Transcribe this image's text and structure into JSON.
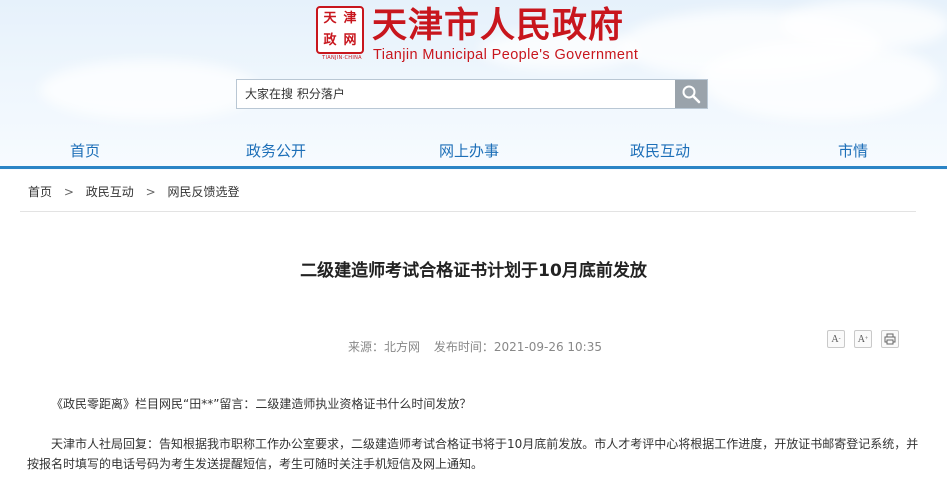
{
  "header": {
    "seal_chars": [
      "天",
      "津",
      "政",
      "网"
    ],
    "seal_caption": "TIANJIN·CHINA",
    "title_cn": "天津市人民政府",
    "title_en": "Tianjin Municipal People's Government",
    "brand_color": "#c8161d"
  },
  "search": {
    "placeholder": "大家在搜 积分落户",
    "icon": "search-icon"
  },
  "nav": {
    "items": [
      "首页",
      "政务公开",
      "网上办事",
      "政民互动",
      "市情"
    ],
    "color": "#1d6fb8",
    "underline_color": "#2a84c6"
  },
  "breadcrumb": {
    "items": [
      "首页",
      "政民互动",
      "网民反馈选登"
    ],
    "separator": ">"
  },
  "article": {
    "title": "二级建造师考试合格证书计划于10月底前发放",
    "source": "来源：北方网",
    "publish_time": "发布时间：2021-09-26 10:35",
    "tools": {
      "font_decrease": "A",
      "font_increase": "A",
      "print_icon": "print-icon"
    },
    "paragraphs": [
      "《政民零距离》栏目网民“田**”留言：二级建造师执业资格证书什么时间发放？",
      "天津市人社局回复：告知根据我市职称工作办公室要求，二级建造师考试合格证书将于10月底前发放。市人才考评中心将根据工作进度，开放证书邮寄登记系统，并按报名时填写的电话号码为考生发送提醒短信，考生可随时关注手机短信及网上通知。"
    ]
  }
}
